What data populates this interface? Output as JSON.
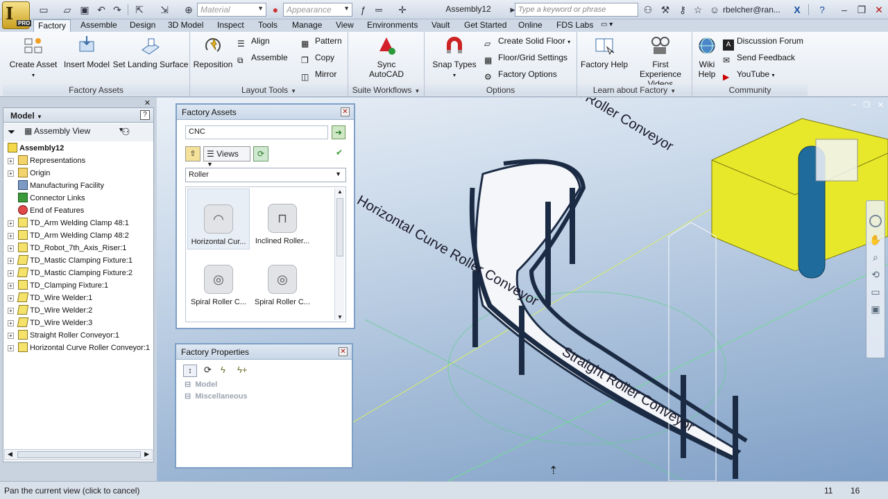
{
  "window": {
    "doc_title": "Assembly12",
    "material_placeholder": "Material",
    "appearance_placeholder": "Appearance",
    "search_placeholder": "Type a keyword or phrase",
    "user": "rbelcher@ran..."
  },
  "tabs": [
    "Factory",
    "Assemble",
    "Design",
    "3D Model",
    "Inspect",
    "Tools",
    "Manage",
    "View",
    "Environments",
    "Vault",
    "Get Started",
    "Online",
    "FDS Labs"
  ],
  "ribbon": {
    "factory_assets": {
      "title": "Factory Assets",
      "create_asset": "Create Asset",
      "insert_model": "Insert Model",
      "set_landing_surface": "Set Landing Surface"
    },
    "layout_tools": {
      "title": "Layout Tools",
      "reposition": "Reposition",
      "align": "Align",
      "assemble": "Assemble",
      "pattern": "Pattern",
      "copy": "Copy",
      "mirror": "Mirror"
    },
    "suite_workflows": {
      "title": "Suite Workflows",
      "sync_autocad_1": "Sync",
      "sync_autocad_2": "AutoCAD"
    },
    "options": {
      "title": "Options",
      "snap_types": "Snap Types",
      "create_solid_floor": "Create Solid Floor",
      "floor_grid_settings": "Floor/Grid Settings",
      "factory_options": "Factory Options"
    },
    "learn": {
      "title": "Learn about Factory",
      "factory_help": "Factory Help",
      "first_experience_1": "First Experience",
      "first_experience_2": "Videos"
    },
    "community": {
      "title": "Community",
      "wiki_help_1": "Wiki",
      "wiki_help_2": "Help",
      "discussion_forum": "Discussion Forum",
      "send_feedback": "Send Feedback",
      "youtube": "YouTube"
    }
  },
  "browser": {
    "title": "Model",
    "view_mode": "Assembly View",
    "root": "Assembly12",
    "items": [
      {
        "label": "Representations",
        "expandable": true,
        "icon": "folder"
      },
      {
        "label": "Origin",
        "expandable": true,
        "icon": "folder"
      },
      {
        "label": "Manufacturing Facility",
        "expandable": false,
        "icon": "facility"
      },
      {
        "label": "Connector Links",
        "expandable": false,
        "icon": "connector"
      },
      {
        "label": "End of Features",
        "expandable": false,
        "icon": "end"
      },
      {
        "label": "TD_Arm Welding Clamp 48:1",
        "expandable": true,
        "icon": "part"
      },
      {
        "label": "TD_Arm Welding Clamp 48:2",
        "expandable": true,
        "icon": "part"
      },
      {
        "label": "TD_Robot_7th_Axis_Riser:1",
        "expandable": true,
        "icon": "part"
      },
      {
        "label": "TD_Mastic Clamping Fixture:1",
        "expandable": true,
        "icon": "part2"
      },
      {
        "label": "TD_Mastic Clamping Fixture:2",
        "expandable": true,
        "icon": "part2"
      },
      {
        "label": "TD_Clamping Fixture:1",
        "expandable": true,
        "icon": "part"
      },
      {
        "label": "TD_Wire Welder:1",
        "expandable": true,
        "icon": "part2"
      },
      {
        "label": "TD_Wire Welder:2",
        "expandable": true,
        "icon": "part2"
      },
      {
        "label": "TD_Wire Welder:3",
        "expandable": true,
        "icon": "part2"
      },
      {
        "label": "Straight Roller Conveyor:1",
        "expandable": true,
        "icon": "part"
      },
      {
        "label": "Horizontal Curve Roller Conveyor:1",
        "expandable": true,
        "icon": "part"
      }
    ]
  },
  "factory_assets_palette": {
    "title": "Factory Assets",
    "search_value": "CNC",
    "views_label": "Views",
    "category": "Roller",
    "assets": [
      "Horizontal Cur...",
      "Inclined Roller...",
      "Spiral Roller C...",
      "Spiral Roller C..."
    ]
  },
  "factory_properties_palette": {
    "title": "Factory Properties",
    "groups": [
      "Model",
      "Miscellaneous"
    ]
  },
  "viewport_labels": {
    "straight_top": "Straight Roller Conveyor",
    "curve_label": "Horizontal Curve Roller Conveyor",
    "straight_bottom": "Straight Roller Conveyor"
  },
  "status": {
    "message": "Pan the current view (click to cancel)",
    "count_a": "11",
    "count_b": "16"
  }
}
